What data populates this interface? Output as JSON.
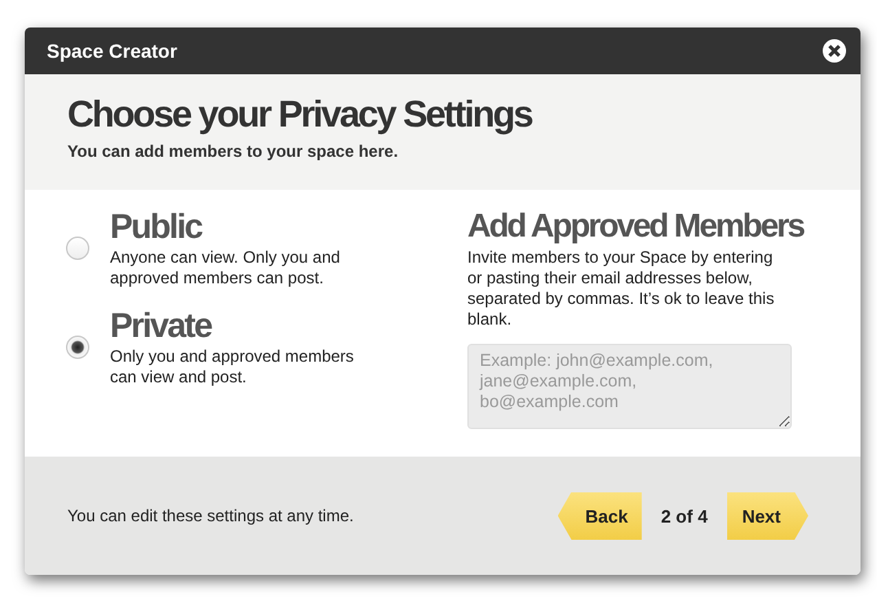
{
  "window": {
    "title": "Space Creator"
  },
  "header": {
    "title": "Choose your Privacy Settings",
    "subtitle": "You can add members to your space here."
  },
  "privacy_options": [
    {
      "label": "Public",
      "description": "Anyone can view. Only you and approved members can post.",
      "selected": false
    },
    {
      "label": "Private",
      "description": "Only you and approved members can view and post.",
      "selected": true
    }
  ],
  "members": {
    "title": "Add Approved Members",
    "description": "Invite members to your Space by entering or pasting their email addresses below, separated by commas. It’s ok to leave this blank.",
    "placeholder": "Example: john@example.com,\njane@example.com,\nbo@example.com"
  },
  "footer": {
    "note": "You can edit these settings at any time.",
    "back": "Back",
    "step": "2 of 4",
    "next": "Next"
  }
}
